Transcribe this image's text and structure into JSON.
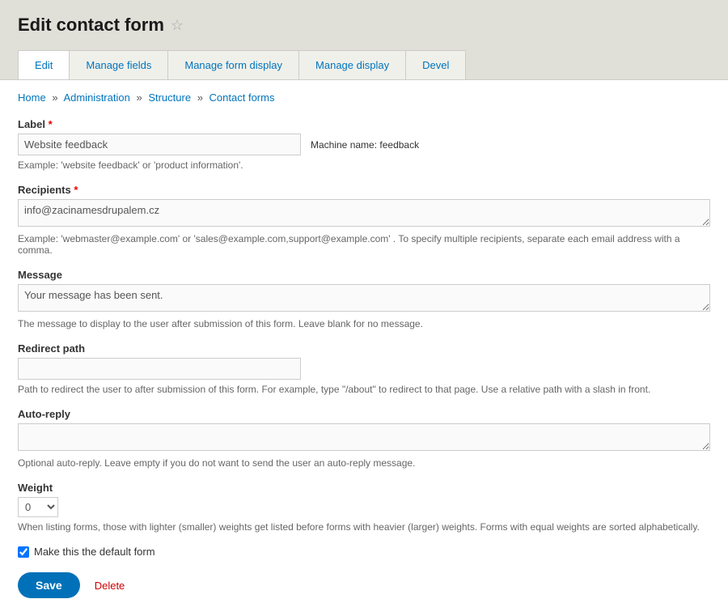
{
  "page_title": "Edit contact form",
  "tabs": {
    "edit": "Edit",
    "manage_fields": "Manage fields",
    "manage_form_display": "Manage form display",
    "manage_display": "Manage display",
    "devel": "Devel"
  },
  "breadcrumb": {
    "home": "Home",
    "administration": "Administration",
    "structure": "Structure",
    "contact_forms": "Contact forms",
    "sep": "»"
  },
  "fields": {
    "label": {
      "label": "Label",
      "value": "Website feedback",
      "machine_name_label": "Machine name:",
      "machine_name_value": "feedback",
      "description": "Example: 'website feedback' or 'product information'."
    },
    "recipients": {
      "label": "Recipients",
      "value": "info@zacinamesdrupalem.cz",
      "description": "Example: 'webmaster@example.com' or 'sales@example.com,support@example.com' . To specify multiple recipients, separate each email address with a comma."
    },
    "message": {
      "label": "Message",
      "value": "Your message has been sent.",
      "description": "The message to display to the user after submission of this form. Leave blank for no message."
    },
    "redirect": {
      "label": "Redirect path",
      "value": "",
      "description": "Path to redirect the user to after submission of this form. For example, type \"/about\" to redirect to that page. Use a relative path with a slash in front."
    },
    "auto_reply": {
      "label": "Auto-reply",
      "value": "",
      "description": "Optional auto-reply. Leave empty if you do not want to send the user an auto-reply message."
    },
    "weight": {
      "label": "Weight",
      "value": "0",
      "description": "When listing forms, those with lighter (smaller) weights get listed before forms with heavier (larger) weights. Forms with equal weights are sorted alphabetically."
    },
    "default": {
      "label": "Make this the default form",
      "checked": true
    }
  },
  "actions": {
    "save": "Save",
    "delete": "Delete"
  }
}
